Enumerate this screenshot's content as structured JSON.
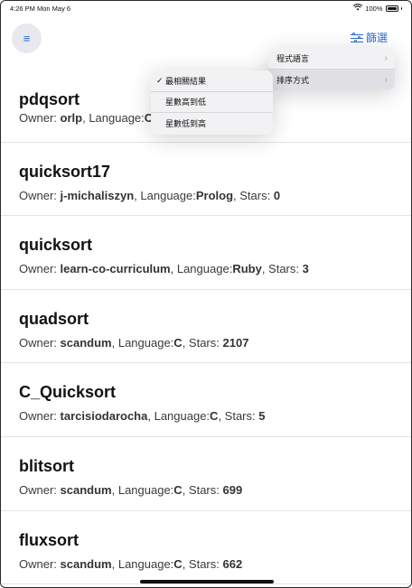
{
  "status_bar": {
    "time": "4:26 PM",
    "date": "Mon May 6",
    "battery": "100%"
  },
  "nav": {
    "filter_label": "篩選"
  },
  "filter_menu": {
    "items": [
      {
        "label": "程式語言"
      },
      {
        "label": "排序方式"
      }
    ]
  },
  "sort_menu": {
    "items": [
      {
        "label": "最相關結果",
        "checked": true
      },
      {
        "label": "星數高到低",
        "checked": false
      },
      {
        "label": "星數低到高",
        "checked": false
      }
    ],
    "check_mark": "✓"
  },
  "labels": {
    "owner": "Owner:",
    "language": ", Language:",
    "stars": ", Stars:"
  },
  "repos": [
    {
      "name": "pdqsort",
      "owner": "orlp",
      "language": "C",
      "stars": ""
    },
    {
      "name": "quicksort17",
      "owner": "j-michaliszyn",
      "language": "Prolog",
      "stars": "0"
    },
    {
      "name": "quicksort",
      "owner": "learn-co-curriculum",
      "language": "Ruby",
      "stars": "3"
    },
    {
      "name": "quadsort",
      "owner": "scandum",
      "language": "C",
      "stars": "2107"
    },
    {
      "name": "C_Quicksort",
      "owner": "tarcisiodarocha",
      "language": "C",
      "stars": "5"
    },
    {
      "name": "blitsort",
      "owner": "scandum",
      "language": "C",
      "stars": "699"
    },
    {
      "name": "fluxsort",
      "owner": "scandum",
      "language": "C",
      "stars": "662"
    }
  ]
}
